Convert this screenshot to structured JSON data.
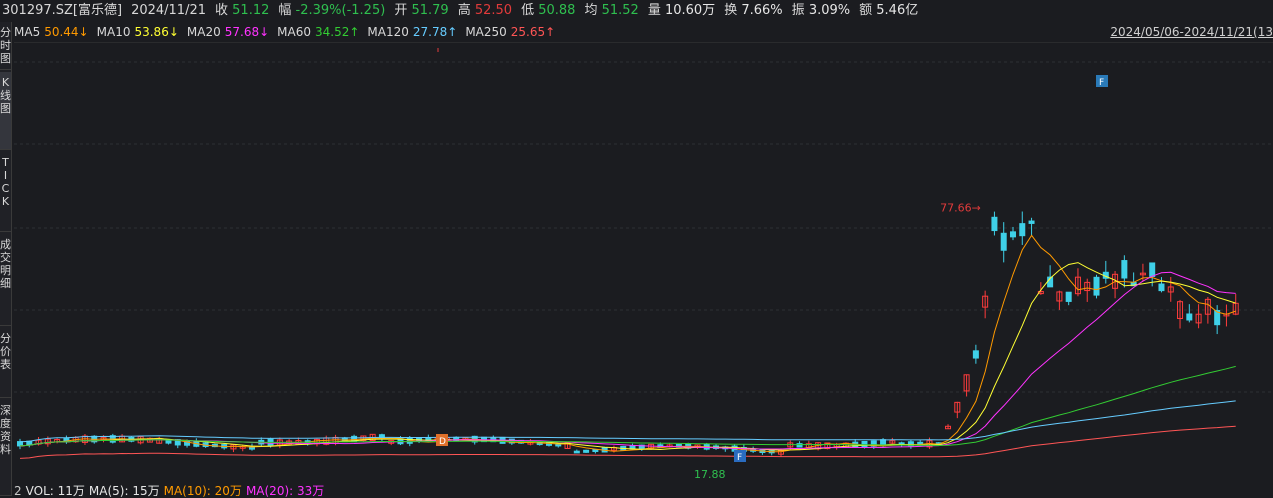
{
  "quote": {
    "symbol": "301297.SZ[富乐德]",
    "date": "2024/11/21",
    "close_label": "收",
    "close": "51.12",
    "change_label": "幅",
    "change": "-2.39%(-1.25)",
    "open_label": "开",
    "open": "51.79",
    "high_label": "高",
    "high": "52.50",
    "low_label": "低",
    "low": "50.88",
    "avg_label": "均",
    "avg": "51.52",
    "volume_label": "量",
    "volume": "10.60万",
    "turnover_label": "换",
    "turnover": "7.66%",
    "amplitude_label": "振",
    "amplitude": "3.09%",
    "amount_label": "额",
    "amount": "5.46亿"
  },
  "ma_legend": [
    {
      "label": "MA5",
      "value": "50.44↓",
      "color": "#ff9a00"
    },
    {
      "label": "MA10",
      "value": "53.86↓",
      "color": "#ffff33"
    },
    {
      "label": "MA20",
      "value": "57.68↓",
      "color": "#ff33ff"
    },
    {
      "label": "MA60",
      "value": "34.52↑",
      "color": "#33cc33"
    },
    {
      "label": "MA120",
      "value": "27.78↑",
      "color": "#66ccff"
    },
    {
      "label": "MA250",
      "value": "25.65↑",
      "color": "#ff5555"
    }
  ],
  "date_range": "2024/05/06-2024/11/21(13",
  "sidebar": [
    {
      "label": "分时图",
      "chars": [
        "分",
        "时",
        "图"
      ],
      "active": false
    },
    {
      "label": "K线图",
      "chars": [
        "K",
        "线",
        "图"
      ],
      "active": true
    },
    {
      "label": "TICK",
      "chars": [
        "T",
        "I",
        "C",
        "K"
      ],
      "active": false
    },
    {
      "label": "成交明细",
      "chars": [
        "成",
        "交",
        "明",
        "细"
      ],
      "active": false
    },
    {
      "label": "分价表",
      "chars": [
        "分",
        "价",
        "表"
      ],
      "active": false
    },
    {
      "label": "深度资料",
      "chars": [
        "深",
        "度",
        "资",
        "料"
      ],
      "active": false
    }
  ],
  "chart_data": {
    "type": "candlestick",
    "high_label": "77.66",
    "low_label": "17.88",
    "markers": [
      "D",
      "F",
      "F"
    ]
  },
  "volume_legend": {
    "items": [
      {
        "text": "2",
        "color": "#c8c8c8"
      },
      {
        "text": "VOL: 11万",
        "color": "#e6e6e6"
      },
      {
        "text": "MA(5): 15万",
        "color": "#e6e6e6"
      },
      {
        "text": "MA(10): 20万",
        "color": "#ff9a00"
      },
      {
        "text": "MA(20): 33万",
        "color": "#ff33ff"
      }
    ]
  }
}
